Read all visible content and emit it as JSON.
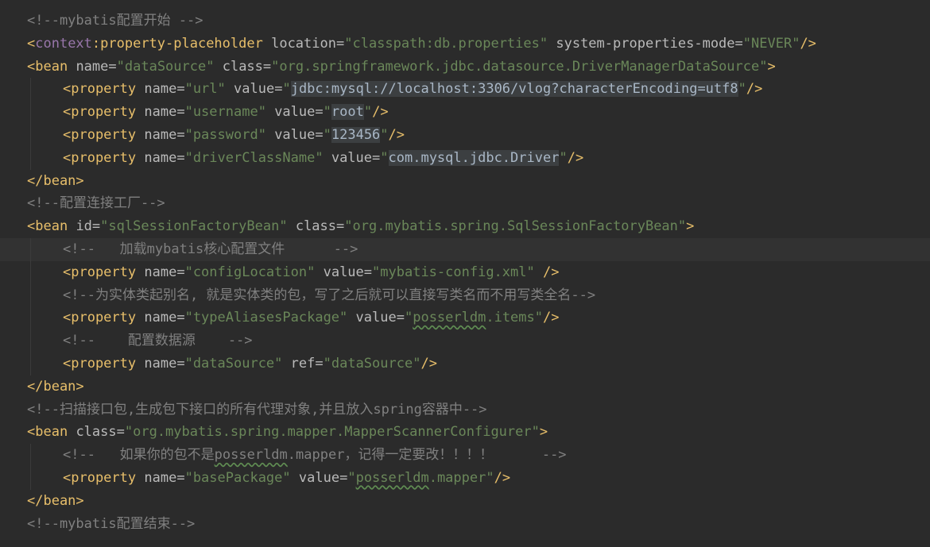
{
  "lines": [
    {
      "segments": [
        {
          "t": "<!--mybatis配置开始 -->",
          "c": "comment"
        }
      ]
    },
    {
      "segments": [
        {
          "t": "<",
          "c": "tag"
        },
        {
          "t": "context",
          "c": "ns"
        },
        {
          "t": ":property-placeholder",
          "c": "tag"
        },
        {
          "t": " ",
          "c": "plain"
        },
        {
          "t": "location",
          "c": "attr"
        },
        {
          "t": "=",
          "c": "attr"
        },
        {
          "t": "\"classpath:db.properties\"",
          "c": "str"
        },
        {
          "t": " ",
          "c": "plain"
        },
        {
          "t": "system-properties-mode",
          "c": "attr"
        },
        {
          "t": "=",
          "c": "attr"
        },
        {
          "t": "\"NEVER\"",
          "c": "str"
        },
        {
          "t": "/>",
          "c": "tag"
        }
      ]
    },
    {
      "segments": [
        {
          "t": "<bean",
          "c": "tag"
        },
        {
          "t": " ",
          "c": "plain"
        },
        {
          "t": "name",
          "c": "attr"
        },
        {
          "t": "=",
          "c": "attr"
        },
        {
          "t": "\"dataSource\"",
          "c": "str"
        },
        {
          "t": " ",
          "c": "plain"
        },
        {
          "t": "class",
          "c": "attr"
        },
        {
          "t": "=",
          "c": "attr"
        },
        {
          "t": "\"org.springframework.jdbc.datasource.DriverManagerDataSource\"",
          "c": "str"
        },
        {
          "t": ">",
          "c": "tag"
        }
      ]
    },
    {
      "indent": true,
      "segments": [
        {
          "t": "<property",
          "c": "tag"
        },
        {
          "t": " ",
          "c": "plain"
        },
        {
          "t": "name",
          "c": "attr"
        },
        {
          "t": "=",
          "c": "attr"
        },
        {
          "t": "\"url\"",
          "c": "str"
        },
        {
          "t": " ",
          "c": "plain"
        },
        {
          "t": "value",
          "c": "attr"
        },
        {
          "t": "=",
          "c": "attr"
        },
        {
          "t": "\"",
          "c": "str"
        },
        {
          "t": "jdbc:mysql://localhost:3306/vlog?characterEncoding=utf8",
          "c": "hl"
        },
        {
          "t": "\"",
          "c": "str"
        },
        {
          "t": "/>",
          "c": "tag"
        }
      ]
    },
    {
      "indent": true,
      "segments": [
        {
          "t": "<property",
          "c": "tag"
        },
        {
          "t": " ",
          "c": "plain"
        },
        {
          "t": "name",
          "c": "attr"
        },
        {
          "t": "=",
          "c": "attr"
        },
        {
          "t": "\"username\"",
          "c": "str"
        },
        {
          "t": " ",
          "c": "plain"
        },
        {
          "t": "value",
          "c": "attr"
        },
        {
          "t": "=",
          "c": "attr"
        },
        {
          "t": "\"",
          "c": "str"
        },
        {
          "t": "root",
          "c": "hl"
        },
        {
          "t": "\"",
          "c": "str"
        },
        {
          "t": "/>",
          "c": "tag"
        }
      ]
    },
    {
      "indent": true,
      "segments": [
        {
          "t": "<property",
          "c": "tag"
        },
        {
          "t": " ",
          "c": "plain"
        },
        {
          "t": "name",
          "c": "attr"
        },
        {
          "t": "=",
          "c": "attr"
        },
        {
          "t": "\"password\"",
          "c": "str"
        },
        {
          "t": " ",
          "c": "plain"
        },
        {
          "t": "value",
          "c": "attr"
        },
        {
          "t": "=",
          "c": "attr"
        },
        {
          "t": "\"",
          "c": "str"
        },
        {
          "t": "123456",
          "c": "hl"
        },
        {
          "t": "\"",
          "c": "str"
        },
        {
          "t": "/>",
          "c": "tag"
        }
      ]
    },
    {
      "indent": true,
      "segments": [
        {
          "t": "<property",
          "c": "tag"
        },
        {
          "t": " ",
          "c": "plain"
        },
        {
          "t": "name",
          "c": "attr"
        },
        {
          "t": "=",
          "c": "attr"
        },
        {
          "t": "\"driverClassName\"",
          "c": "str"
        },
        {
          "t": " ",
          "c": "plain"
        },
        {
          "t": "value",
          "c": "attr"
        },
        {
          "t": "=",
          "c": "attr"
        },
        {
          "t": "\"",
          "c": "str"
        },
        {
          "t": "com.mysql.jdbc.Driver",
          "c": "hl"
        },
        {
          "t": "\"",
          "c": "str"
        },
        {
          "t": "/>",
          "c": "tag"
        }
      ]
    },
    {
      "segments": [
        {
          "t": "</bean>",
          "c": "tag"
        }
      ]
    },
    {
      "segments": [
        {
          "t": "<!--配置连接工厂-->",
          "c": "comment"
        }
      ]
    },
    {
      "segments": [
        {
          "t": "<bean",
          "c": "tag"
        },
        {
          "t": " ",
          "c": "plain"
        },
        {
          "t": "id",
          "c": "attr"
        },
        {
          "t": "=",
          "c": "attr"
        },
        {
          "t": "\"sqlSessionFactoryBean\"",
          "c": "str"
        },
        {
          "t": " ",
          "c": "plain"
        },
        {
          "t": "class",
          "c": "attr"
        },
        {
          "t": "=",
          "c": "attr"
        },
        {
          "t": "\"org.mybatis.spring.SqlSessionFactoryBean\"",
          "c": "str"
        },
        {
          "t": ">",
          "c": "tag"
        }
      ]
    },
    {
      "indent": true,
      "current": true,
      "segments": [
        {
          "t": "<!--   加载mybatis核心配置文件      -->",
          "c": "comment"
        }
      ]
    },
    {
      "indent": true,
      "segments": [
        {
          "t": "<property",
          "c": "tag"
        },
        {
          "t": " ",
          "c": "plain"
        },
        {
          "t": "name",
          "c": "attr"
        },
        {
          "t": "=",
          "c": "attr"
        },
        {
          "t": "\"configLocation\"",
          "c": "str"
        },
        {
          "t": " ",
          "c": "plain"
        },
        {
          "t": "value",
          "c": "attr"
        },
        {
          "t": "=",
          "c": "attr"
        },
        {
          "t": "\"mybatis-config.xml\"",
          "c": "str"
        },
        {
          "t": " ",
          "c": "plain"
        },
        {
          "t": "/>",
          "c": "tag"
        }
      ]
    },
    {
      "indent": true,
      "segments": [
        {
          "t": "<!--为实体类起别名, 就是实体类的包，写了之后就可以直接写类名而不用写类全名-->",
          "c": "comment"
        }
      ]
    },
    {
      "indent": true,
      "segments": [
        {
          "t": "<property",
          "c": "tag"
        },
        {
          "t": " ",
          "c": "plain"
        },
        {
          "t": "name",
          "c": "attr"
        },
        {
          "t": "=",
          "c": "attr"
        },
        {
          "t": "\"typeAliasesPackage\"",
          "c": "str"
        },
        {
          "t": " ",
          "c": "plain"
        },
        {
          "t": "value",
          "c": "attr"
        },
        {
          "t": "=",
          "c": "attr"
        },
        {
          "t": "\"",
          "c": "str"
        },
        {
          "t": "posserldm",
          "c": "str-typo"
        },
        {
          "t": ".items\"",
          "c": "str"
        },
        {
          "t": "/>",
          "c": "tag"
        }
      ]
    },
    {
      "indent": true,
      "segments": [
        {
          "t": "<!--    配置数据源    -->",
          "c": "comment"
        }
      ]
    },
    {
      "indent": true,
      "segments": [
        {
          "t": "<property",
          "c": "tag"
        },
        {
          "t": " ",
          "c": "plain"
        },
        {
          "t": "name",
          "c": "attr"
        },
        {
          "t": "=",
          "c": "attr"
        },
        {
          "t": "\"dataSource\"",
          "c": "str"
        },
        {
          "t": " ",
          "c": "plain"
        },
        {
          "t": "ref",
          "c": "attr"
        },
        {
          "t": "=",
          "c": "attr"
        },
        {
          "t": "\"dataSource\"",
          "c": "str"
        },
        {
          "t": "/>",
          "c": "tag"
        }
      ]
    },
    {
      "segments": [
        {
          "t": "</bean>",
          "c": "tag"
        }
      ]
    },
    {
      "segments": [
        {
          "t": "<!--扫描接口包,生成包下接口的所有代理对象,并且放入spring容器中-->",
          "c": "comment"
        }
      ]
    },
    {
      "segments": [
        {
          "t": "<bean",
          "c": "tag"
        },
        {
          "t": " ",
          "c": "plain"
        },
        {
          "t": "class",
          "c": "attr"
        },
        {
          "t": "=",
          "c": "attr"
        },
        {
          "t": "\"org.mybatis.spring.mapper.MapperScannerConfigurer\"",
          "c": "str"
        },
        {
          "t": ">",
          "c": "tag"
        }
      ]
    },
    {
      "indent": true,
      "segments": [
        {
          "t": "<!--   如果你的包不是",
          "c": "comment"
        },
        {
          "t": "posserldm",
          "c": "comment-typo"
        },
        {
          "t": ".mapper，记得一定要改！！！！      -->",
          "c": "comment"
        }
      ]
    },
    {
      "indent": true,
      "segments": [
        {
          "t": "<property",
          "c": "tag"
        },
        {
          "t": " ",
          "c": "plain"
        },
        {
          "t": "name",
          "c": "attr"
        },
        {
          "t": "=",
          "c": "attr"
        },
        {
          "t": "\"basePackage\"",
          "c": "str"
        },
        {
          "t": " ",
          "c": "plain"
        },
        {
          "t": "value",
          "c": "attr"
        },
        {
          "t": "=",
          "c": "attr"
        },
        {
          "t": "\"",
          "c": "str"
        },
        {
          "t": "posserldm",
          "c": "str-typo"
        },
        {
          "t": ".mapper\"",
          "c": "str"
        },
        {
          "t": "/>",
          "c": "tag"
        }
      ]
    },
    {
      "segments": [
        {
          "t": "</bean>",
          "c": "tag"
        }
      ]
    },
    {
      "segments": [
        {
          "t": "<!--mybatis配置结束-->",
          "c": "comment"
        }
      ]
    }
  ]
}
